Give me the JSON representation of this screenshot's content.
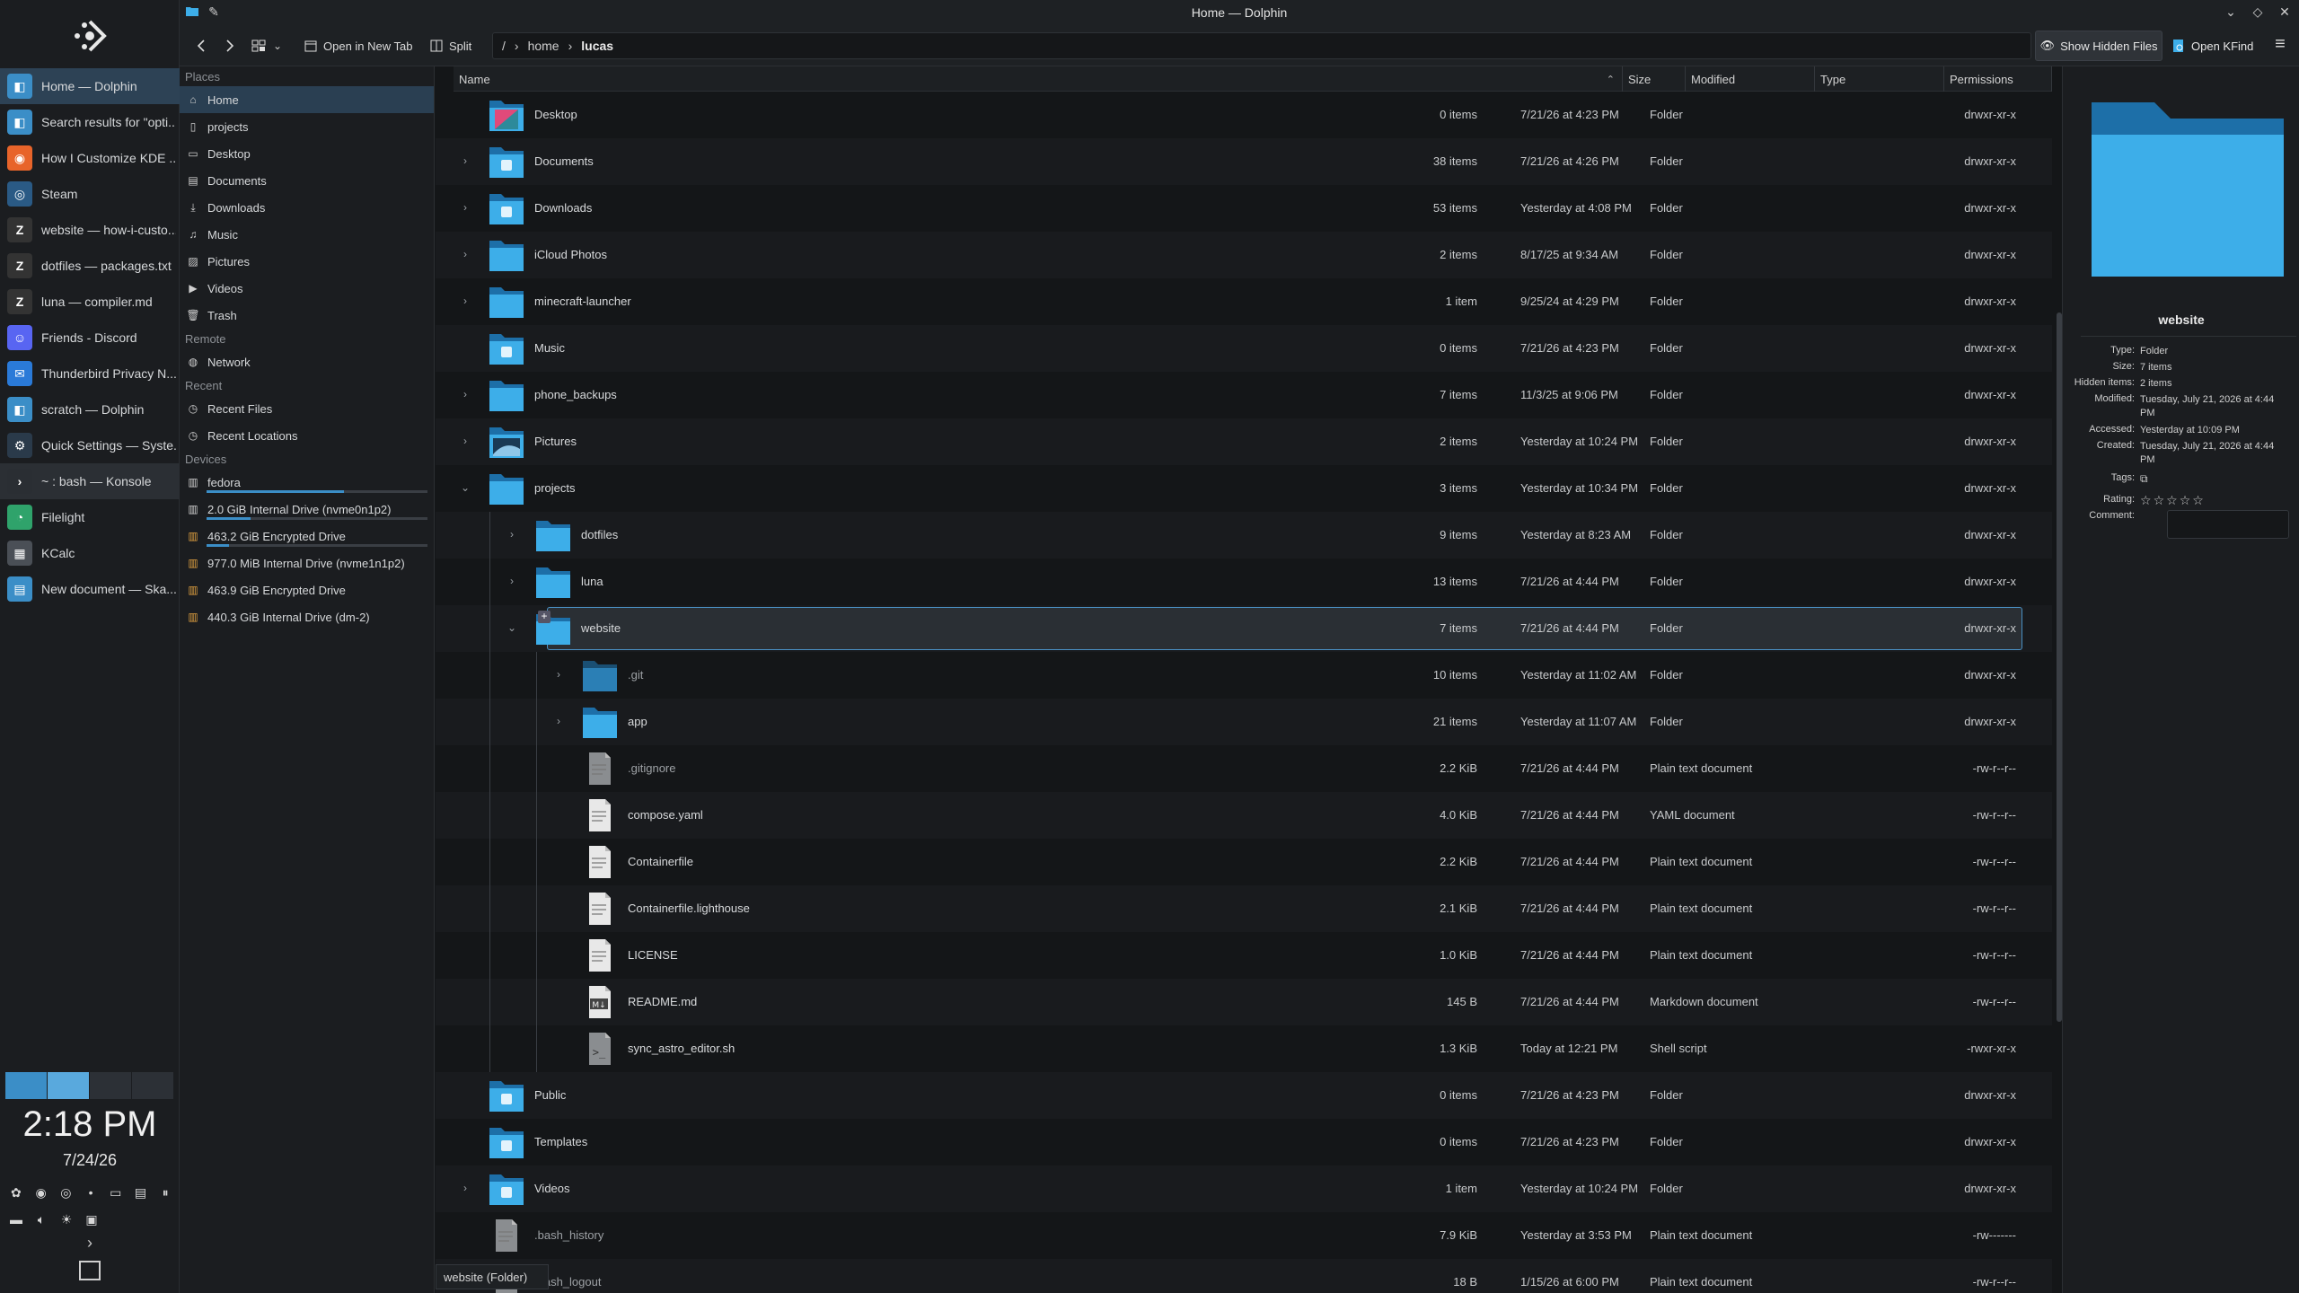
{
  "window": {
    "title": "Home — Dolphin"
  },
  "taskbar": {
    "tasks": [
      {
        "label": "Home — Dolphin",
        "icon": "dolphin-icon",
        "color": "#3b8ec7",
        "state": "active"
      },
      {
        "label": "Search results for \"opti...",
        "icon": "dolphin-icon",
        "color": "#3b8ec7",
        "state": ""
      },
      {
        "label": "How I Customize KDE ...",
        "icon": "firefox-icon",
        "color": "#e8642a",
        "state": ""
      },
      {
        "label": "Steam",
        "icon": "steam-icon",
        "color": "#2a5a85",
        "state": ""
      },
      {
        "label": "website — how-i-custo...",
        "icon": "zed-icon",
        "color": "#333",
        "state": ""
      },
      {
        "label": "dotfiles — packages.txt",
        "icon": "zed-icon",
        "color": "#333",
        "state": ""
      },
      {
        "label": "luna — compiler.md",
        "icon": "zed-icon",
        "color": "#333",
        "state": ""
      },
      {
        "label": "Friends - Discord",
        "icon": "discord-icon",
        "color": "#5865f2",
        "state": ""
      },
      {
        "label": "Thunderbird Privacy N...",
        "icon": "thunderbird-icon",
        "color": "#2a7ad8",
        "state": ""
      },
      {
        "label": "scratch — Dolphin",
        "icon": "dolphin-icon",
        "color": "#3b8ec7",
        "state": ""
      },
      {
        "label": "Quick Settings — Syste...",
        "icon": "settings-icon",
        "color": "#2a3a4a",
        "state": ""
      },
      {
        "label": "~ : bash — Konsole",
        "icon": "konsole-icon",
        "color": "#2a2e33",
        "state": "focused"
      },
      {
        "label": "Filelight",
        "icon": "filelight-icon",
        "color": "#2fa36b",
        "state": ""
      },
      {
        "label": "KCalc",
        "icon": "kcalc-icon",
        "color": "#4a4f56",
        "state": ""
      },
      {
        "label": "New document — Ska...",
        "icon": "skanpage-icon",
        "color": "#3b8ec7",
        "state": ""
      }
    ],
    "clock": {
      "time": "2:18 PM",
      "date": "7/24/26"
    }
  },
  "toolbar": {
    "open_new_tab": "Open in New Tab",
    "split": "Split",
    "location": {
      "root": "/",
      "crumbs": [
        "home",
        "lucas"
      ]
    },
    "show_hidden": "Show Hidden Files",
    "open_kfind": "Open KFind"
  },
  "places": {
    "sections": {
      "places": "Places",
      "remote": "Remote",
      "recent": "Recent",
      "devices": "Devices"
    },
    "places_items": [
      {
        "label": "Home",
        "icon": "home-icon"
      },
      {
        "label": "projects",
        "icon": "folder-icon"
      },
      {
        "label": "Desktop",
        "icon": "desktop-icon"
      },
      {
        "label": "Documents",
        "icon": "documents-icon"
      },
      {
        "label": "Downloads",
        "icon": "downloads-icon"
      },
      {
        "label": "Music",
        "icon": "music-icon"
      },
      {
        "label": "Pictures",
        "icon": "pictures-icon"
      },
      {
        "label": "Videos",
        "icon": "videos-icon"
      },
      {
        "label": "Trash",
        "icon": "trash-icon"
      }
    ],
    "remote_items": [
      {
        "label": "Network",
        "icon": "network-icon"
      }
    ],
    "recent_items": [
      {
        "label": "Recent Files",
        "icon": "recent-files-icon"
      },
      {
        "label": "Recent Locations",
        "icon": "recent-locations-icon"
      }
    ],
    "device_items": [
      {
        "label": "fedora",
        "icon": "drive-icon",
        "usage": 0.62
      },
      {
        "label": "2.0 GiB Internal Drive (nvme0n1p2)",
        "icon": "drive-icon",
        "usage": 0.2
      },
      {
        "label": "463.2 GiB Encrypted Drive",
        "icon": "encrypted-drive-icon",
        "usage": 0.1
      },
      {
        "label": "977.0 MiB Internal Drive (nvme1n1p2)",
        "icon": "encrypted-drive-icon",
        "usage": null
      },
      {
        "label": "463.9 GiB Encrypted Drive",
        "icon": "encrypted-drive-icon",
        "usage": null
      },
      {
        "label": "440.3 GiB Internal Drive (dm-2)",
        "icon": "encrypted-drive-icon",
        "usage": null
      }
    ]
  },
  "columns": {
    "name": "Name",
    "size": "Size",
    "modified": "Modified",
    "type": "Type",
    "permissions": "Permissions"
  },
  "files": [
    {
      "name": "Desktop",
      "depth": 0,
      "kind": "folder",
      "badge": "desktop",
      "exp": "",
      "size": "0 items",
      "modified": "7/21/26 at 4:23 PM",
      "type": "Folder",
      "perm": "drwxr-xr-x"
    },
    {
      "name": "Documents",
      "depth": 0,
      "kind": "folder",
      "badge": "documents",
      "exp": ">",
      "size": "38 items",
      "modified": "7/21/26 at 4:26 PM",
      "type": "Folder",
      "perm": "drwxr-xr-x"
    },
    {
      "name": "Downloads",
      "depth": 0,
      "kind": "folder",
      "badge": "downloads",
      "exp": ">",
      "size": "53 items",
      "modified": "Yesterday at 4:08 PM",
      "type": "Folder",
      "perm": "drwxr-xr-x"
    },
    {
      "name": "iCloud Photos",
      "depth": 0,
      "kind": "folder",
      "badge": "",
      "exp": ">",
      "size": "2 items",
      "modified": "8/17/25 at 9:34 AM",
      "type": "Folder",
      "perm": "drwxr-xr-x"
    },
    {
      "name": "minecraft-launcher",
      "depth": 0,
      "kind": "folder",
      "badge": "",
      "exp": ">",
      "size": "1 item",
      "modified": "9/25/24 at 4:29 PM",
      "type": "Folder",
      "perm": "drwxr-xr-x"
    },
    {
      "name": "Music",
      "depth": 0,
      "kind": "folder",
      "badge": "music",
      "exp": "",
      "size": "0 items",
      "modified": "7/21/26 at 4:23 PM",
      "type": "Folder",
      "perm": "drwxr-xr-x"
    },
    {
      "name": "phone_backups",
      "depth": 0,
      "kind": "folder",
      "badge": "",
      "exp": ">",
      "size": "7 items",
      "modified": "11/3/25 at 9:06 PM",
      "type": "Folder",
      "perm": "drwxr-xr-x"
    },
    {
      "name": "Pictures",
      "depth": 0,
      "kind": "folder",
      "badge": "pictures",
      "exp": ">",
      "size": "2 items",
      "modified": "Yesterday at 10:24 PM",
      "type": "Folder",
      "perm": "drwxr-xr-x"
    },
    {
      "name": "projects",
      "depth": 0,
      "kind": "folder",
      "badge": "",
      "exp": "v",
      "size": "3 items",
      "modified": "Yesterday at 10:34 PM",
      "type": "Folder",
      "perm": "drwxr-xr-x"
    },
    {
      "name": "dotfiles",
      "depth": 1,
      "kind": "folder",
      "badge": "",
      "exp": ">",
      "size": "9 items",
      "modified": "Yesterday at 8:23 AM",
      "type": "Folder",
      "perm": "drwxr-xr-x"
    },
    {
      "name": "luna",
      "depth": 1,
      "kind": "folder",
      "badge": "",
      "exp": ">",
      "size": "13 items",
      "modified": "7/21/26 at 4:44 PM",
      "type": "Folder",
      "perm": "drwxr-xr-x"
    },
    {
      "name": "website",
      "depth": 1,
      "kind": "folder",
      "badge": "",
      "exp": "v",
      "size": "7 items",
      "modified": "7/21/26 at 4:44 PM",
      "type": "Folder",
      "perm": "drwxr-xr-x",
      "selected": true
    },
    {
      "name": ".git",
      "depth": 2,
      "kind": "folder-dim",
      "badge": "",
      "exp": ">",
      "size": "10 items",
      "modified": "Yesterday at 11:02 AM",
      "type": "Folder",
      "perm": "drwxr-xr-x"
    },
    {
      "name": "app",
      "depth": 2,
      "kind": "folder",
      "badge": "",
      "exp": ">",
      "size": "21 items",
      "modified": "Yesterday at 11:07 AM",
      "type": "Folder",
      "perm": "drwxr-xr-x"
    },
    {
      "name": ".gitignore",
      "depth": 2,
      "kind": "file-dim",
      "badge": "",
      "exp": "",
      "size": "2.2 KiB",
      "modified": "7/21/26 at 4:44 PM",
      "type": "Plain text document",
      "perm": "-rw-r--r--"
    },
    {
      "name": "compose.yaml",
      "depth": 2,
      "kind": "file",
      "badge": "",
      "exp": "",
      "size": "4.0 KiB",
      "modified": "7/21/26 at 4:44 PM",
      "type": "YAML document",
      "perm": "-rw-r--r--"
    },
    {
      "name": "Containerfile",
      "depth": 2,
      "kind": "file",
      "badge": "",
      "exp": "",
      "size": "2.2 KiB",
      "modified": "7/21/26 at 4:44 PM",
      "type": "Plain text document",
      "perm": "-rw-r--r--"
    },
    {
      "name": "Containerfile.lighthouse",
      "depth": 2,
      "kind": "file",
      "badge": "",
      "exp": "",
      "size": "2.1 KiB",
      "modified": "7/21/26 at 4:44 PM",
      "type": "Plain text document",
      "perm": "-rw-r--r--"
    },
    {
      "name": "LICENSE",
      "depth": 2,
      "kind": "file",
      "badge": "",
      "exp": "",
      "size": "1.0 KiB",
      "modified": "7/21/26 at 4:44 PM",
      "type": "Plain text document",
      "perm": "-rw-r--r--"
    },
    {
      "name": "README.md",
      "depth": 2,
      "kind": "file-md",
      "badge": "",
      "exp": "",
      "size": "145 B",
      "modified": "7/21/26 at 4:44 PM",
      "type": "Markdown document",
      "perm": "-rw-r--r--"
    },
    {
      "name": "sync_astro_editor.sh",
      "depth": 2,
      "kind": "file-sh",
      "badge": "",
      "exp": "",
      "size": "1.3 KiB",
      "modified": "Today at 12:21 PM",
      "type": "Shell script",
      "perm": "-rwxr-xr-x"
    },
    {
      "name": "Public",
      "depth": 0,
      "kind": "folder",
      "badge": "public",
      "exp": "",
      "size": "0 items",
      "modified": "7/21/26 at 4:23 PM",
      "type": "Folder",
      "perm": "drwxr-xr-x"
    },
    {
      "name": "Templates",
      "depth": 0,
      "kind": "folder",
      "badge": "templates",
      "exp": "",
      "size": "0 items",
      "modified": "7/21/26 at 4:23 PM",
      "type": "Folder",
      "perm": "drwxr-xr-x"
    },
    {
      "name": "Videos",
      "depth": 0,
      "kind": "folder",
      "badge": "videos",
      "exp": ">",
      "size": "1 item",
      "modified": "Yesterday at 10:24 PM",
      "type": "Folder",
      "perm": "drwxr-xr-x"
    },
    {
      "name": ".bash_history",
      "depth": 0,
      "kind": "file-dim",
      "badge": "",
      "exp": "",
      "size": "7.9 KiB",
      "modified": "Yesterday at 3:53 PM",
      "type": "Plain text document",
      "perm": "-rw-------"
    },
    {
      "name": ".bash_logout",
      "depth": 0,
      "kind": "file-dim",
      "badge": "",
      "exp": "",
      "size": "18 B",
      "modified": "1/15/26 at 6:00 PM",
      "type": "Plain text document",
      "perm": "-rw-r--r--"
    }
  ],
  "statusbar": {
    "text": "website (Folder)"
  },
  "info": {
    "name": "website",
    "labels": {
      "type": "Type:",
      "size": "Size:",
      "hidden": "Hidden items:",
      "modified": "Modified:",
      "accessed": "Accessed:",
      "created": "Created:",
      "tags": "Tags:",
      "rating": "Rating:",
      "comment": "Comment:"
    },
    "type": "Folder",
    "size": "7 items",
    "hidden": "2 items",
    "modified": "Tuesday, July 21, 2026 at 4:44 PM",
    "accessed": "Yesterday at 10:09 PM",
    "created": "Tuesday, July 21, 2026 at 4:44 PM",
    "rating": 0
  },
  "colors": {
    "accent": "#3b8ec7",
    "folder": "#3daee9",
    "background": "#141618"
  }
}
